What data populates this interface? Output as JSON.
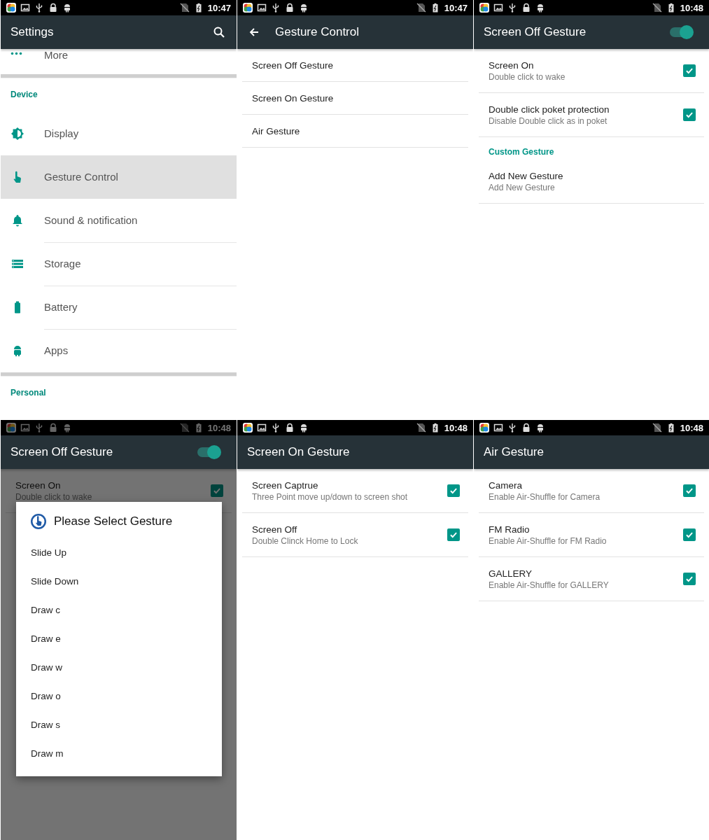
{
  "panels": [
    {
      "kind": "settings",
      "time": "10:47",
      "title": "Settings",
      "search": true,
      "items": [
        {
          "kind": "item",
          "label": "More",
          "selected": false
        },
        {
          "kind": "divider"
        },
        {
          "kind": "header",
          "label": "Device"
        },
        {
          "kind": "item",
          "label": "Display",
          "selected": false
        },
        {
          "kind": "item",
          "label": "Gesture Control",
          "selected": true
        },
        {
          "kind": "item",
          "label": "Sound & notification",
          "selected": false
        },
        {
          "kind": "item",
          "label": "Storage",
          "selected": false
        },
        {
          "kind": "item",
          "label": "Battery",
          "selected": false
        },
        {
          "kind": "item",
          "label": "Apps",
          "selected": false
        },
        {
          "kind": "divider"
        },
        {
          "kind": "header",
          "label": "Personal"
        }
      ]
    },
    {
      "kind": "list",
      "time": "10:47",
      "title": "Gesture Control",
      "back": true,
      "items": [
        {
          "kind": "plain",
          "title": "Screen Off Gesture"
        },
        {
          "kind": "plain",
          "title": "Screen On Gesture"
        },
        {
          "kind": "plain",
          "title": "Air Gesture"
        }
      ]
    },
    {
      "kind": "list",
      "time": "10:48",
      "title": "Screen Off Gesture",
      "toggle": {
        "on": true
      },
      "items": [
        {
          "kind": "check",
          "title": "Screen On",
          "subtitle": "Double click to wake",
          "checked": true
        },
        {
          "kind": "check",
          "title": "Double click poket protection",
          "subtitle": "Disable Double click as in poket",
          "checked": true
        },
        {
          "kind": "header",
          "label": "Custom Gesture"
        },
        {
          "kind": "plain",
          "title": "Add New Gesture",
          "subtitle": "Add New Gesture"
        }
      ]
    },
    {
      "kind": "list",
      "time": "10:48",
      "title": "Screen Off Gesture",
      "toggle": {
        "on": true
      },
      "dimmed": true,
      "items": [
        {
          "kind": "check",
          "title": "Screen On",
          "subtitle": "Double click to wake",
          "checked": true
        }
      ],
      "dialog": {
        "title": "Please Select Gesture",
        "options": [
          "Slide Up",
          "Slide Down",
          "Draw c",
          "Draw e",
          "Draw w",
          "Draw o",
          "Draw s",
          "Draw m"
        ]
      }
    },
    {
      "kind": "list",
      "time": "10:48",
      "title": "Screen On Gesture",
      "items": [
        {
          "kind": "check",
          "title": "Screen Captrue",
          "subtitle": "Three Point move up/down to screen shot",
          "checked": true
        },
        {
          "kind": "check",
          "title": "Screen Off",
          "subtitle": "Double Clinck Home to Lock",
          "checked": true
        }
      ]
    },
    {
      "kind": "list",
      "time": "10:48",
      "title": "Air Gesture",
      "items": [
        {
          "kind": "check",
          "title": "Camera",
          "subtitle": "Enable Air-Shuffle for Camera",
          "checked": true
        },
        {
          "kind": "check",
          "title": "FM Radio",
          "subtitle": "Enable Air-Shuffle for FM Radio",
          "checked": true
        },
        {
          "kind": "check",
          "title": "GALLERY",
          "subtitle": "Enable Air-Shuffle for GALLERY",
          "checked": true
        }
      ]
    }
  ]
}
